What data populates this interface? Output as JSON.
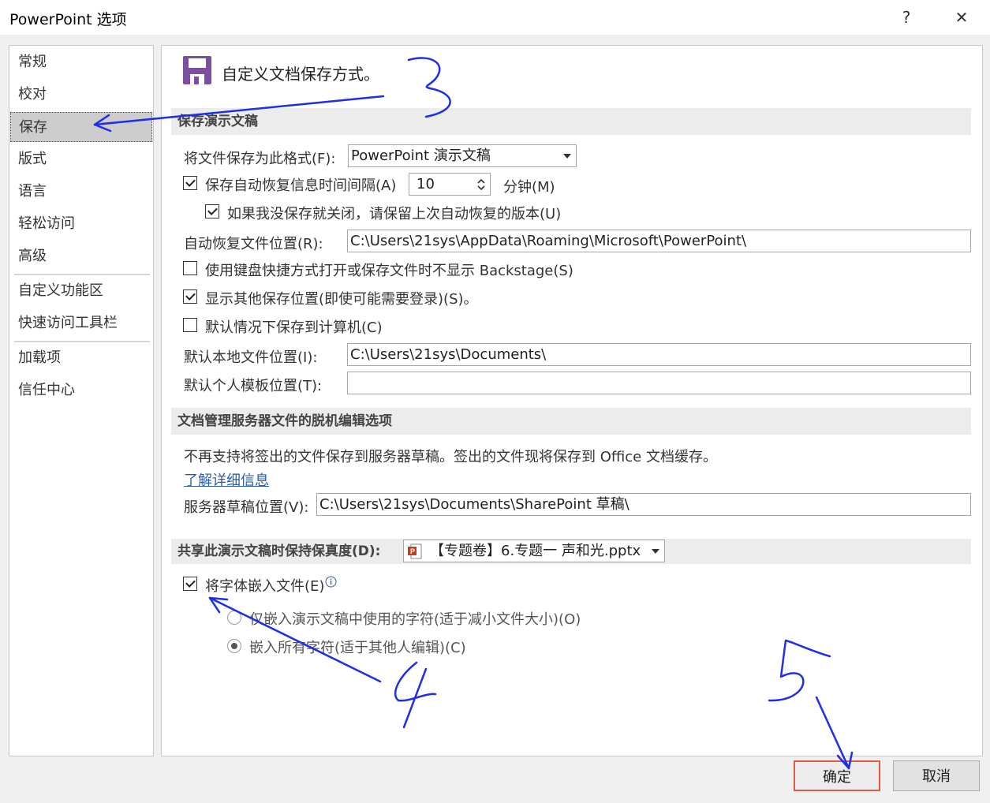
{
  "window": {
    "title": "PowerPoint 选项",
    "help": "?",
    "close": "✕"
  },
  "sidebar": {
    "items": [
      {
        "label": "常规"
      },
      {
        "label": "校对"
      },
      {
        "label": "保存"
      },
      {
        "label": "版式"
      },
      {
        "label": "语言"
      },
      {
        "label": "轻松访问"
      },
      {
        "label": "高级"
      },
      {
        "label": "自定义功能区"
      },
      {
        "label": "快速访问工具栏"
      },
      {
        "label": "加载项"
      },
      {
        "label": "信任中心"
      }
    ],
    "selected": "保存"
  },
  "header": {
    "text": "自定义文档保存方式。",
    "icon": "floppy-disk-icon",
    "icon_color": "#7a4fa0"
  },
  "save_section": {
    "heading": "保存演示文稿",
    "format_label": "将文件保存为此格式(F):",
    "format_value": "PowerPoint 演示文稿",
    "autorecover_label": "保存自动恢复信息时间间隔(A)",
    "autorecover_minutes": "10",
    "minutes_label": "分钟(M)",
    "keep_last_label": "如果我没保存就关闭，请保留上次自动恢复的版本(U)",
    "autorecover_location_label": "自动恢复文件位置(R):",
    "autorecover_location_value": "C:\\Users\\21sys\\AppData\\Roaming\\Microsoft\\PowerPoint\\",
    "no_backstage_label": "使用键盘快捷方式打开或保存文件时不显示 Backstage(S)",
    "show_other_label": "显示其他保存位置(即使可能需要登录)(S)。",
    "save_to_computer_label": "默认情况下保存到计算机(C)",
    "local_location_label": "默认本地文件位置(I):",
    "local_location_value": "C:\\Users\\21sys\\Documents\\",
    "template_location_label": "默认个人模板位置(T):",
    "template_location_value": ""
  },
  "server_section": {
    "heading": "文档管理服务器文件的脱机编辑选项",
    "note": "不再支持将签出的文件保存到服务器草稿。签出的文件现将保存到 Office 文档缓存。",
    "learn_more": "了解详细信息",
    "drafts_label": "服务器草稿位置(V):",
    "drafts_value": "C:\\Users\\21sys\\Documents\\SharePoint 草稿\\"
  },
  "fidelity_section": {
    "heading": "共享此演示文稿时保持保真度(D):",
    "file_value": "【专题卷】6.专题一  声和光.pptx",
    "embed_label": "将字体嵌入文件(E)",
    "embed_used_label": "仅嵌入演示文稿中使用的字符(适于减小文件大小)(O)",
    "embed_all_label": "嵌入所有字符(适于其他人编辑)(C)"
  },
  "checkboxes": {
    "autorecover": true,
    "keep_last": true,
    "no_backstage": false,
    "show_other": true,
    "save_to_computer": false,
    "embed_fonts": true
  },
  "buttons": {
    "ok": "确定",
    "cancel": "取消"
  },
  "annotations": {
    "step3": "3",
    "step4": "4",
    "step5": "5",
    "color": "#1f2fe6"
  }
}
